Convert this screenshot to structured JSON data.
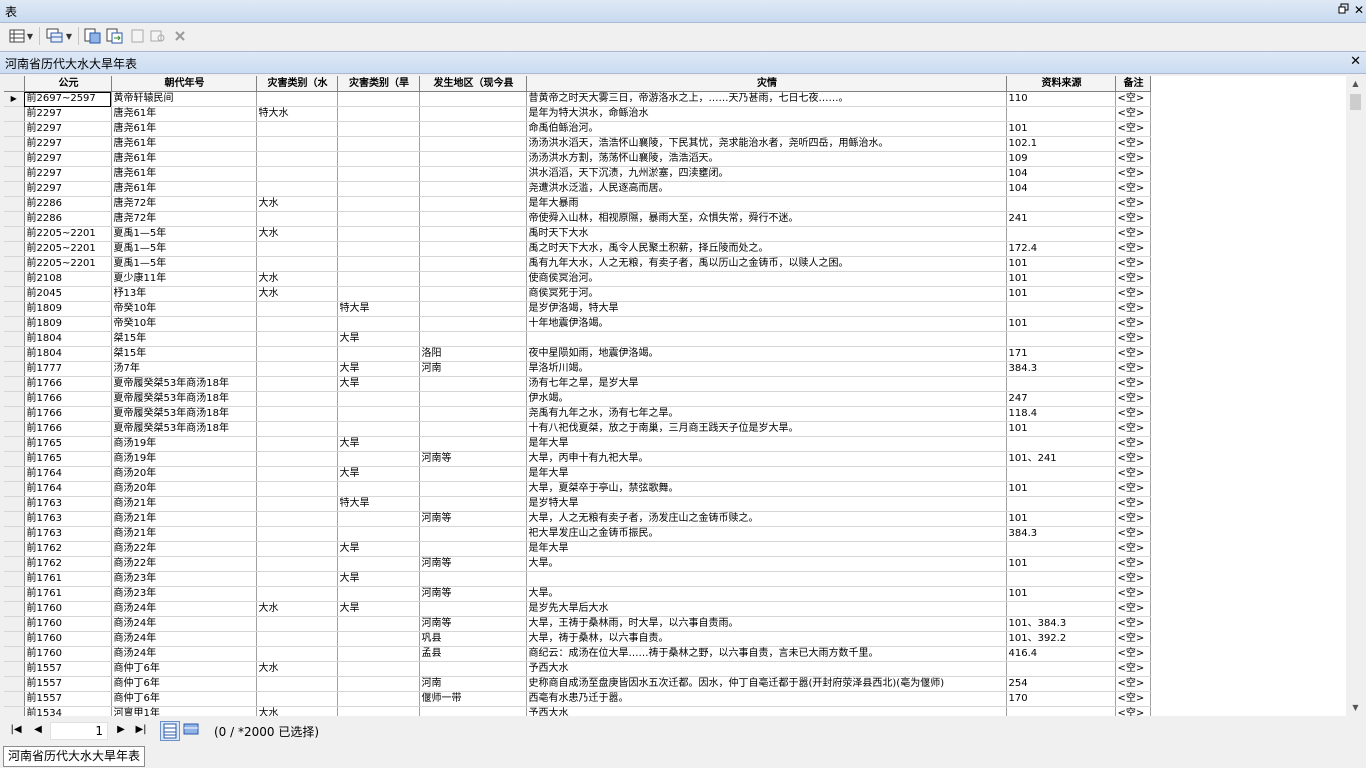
{
  "window": {
    "title": "表"
  },
  "tab": {
    "title": "河南省历代大水大旱年表"
  },
  "columns": [
    "公元",
    "朝代年号",
    "灾害类别（水",
    "灾害类别（旱",
    "发生地区（现今县",
    "灾情",
    "资料来源",
    "备注"
  ],
  "rows": [
    [
      "前2697~2597",
      "黄帝轩辕民间",
      "",
      "",
      "",
      "昔黄帝之时天大雾三日，帝游洛水之上，……天乃甚雨，七日七夜……。",
      "110",
      "<空>"
    ],
    [
      "前2297",
      "唐尧61年",
      "特大水",
      "",
      "",
      "是年为特大洪水，命鲧治水",
      "",
      "<空>"
    ],
    [
      "前2297",
      "唐尧61年",
      "",
      "",
      "",
      "命禹伯鲧治河。",
      "101",
      "<空>"
    ],
    [
      "前2297",
      "唐尧61年",
      "",
      "",
      "",
      "汤汤洪水滔天，浩浩怀山襄陵，下民其忧，尧求能治水者，尧听四岳，用鲧治水。",
      "102.1",
      "<空>"
    ],
    [
      "前2297",
      "唐尧61年",
      "",
      "",
      "",
      "汤汤洪水方割，荡荡怀山襄陵，浩浩滔天。",
      "109",
      "<空>"
    ],
    [
      "前2297",
      "唐尧61年",
      "",
      "",
      "",
      "洪水滔滔，天下沉渍，九州淤塞，四渎壅闭。",
      "104",
      "<空>"
    ],
    [
      "前2297",
      "唐尧61年",
      "",
      "",
      "",
      "尧遭洪水泛滥，人民逐高而居。",
      "104",
      "<空>"
    ],
    [
      "前2286",
      "唐尧72年",
      "大水",
      "",
      "",
      "是年大暴雨",
      "",
      "<空>"
    ],
    [
      "前2286",
      "唐尧72年",
      "",
      "",
      "",
      "帝使舜入山林，相视原隰，暴雨大至，众惧失常，舜行不迷。",
      "241",
      "<空>"
    ],
    [
      "前2205~2201",
      "夏禹1—5年",
      "大水",
      "",
      "",
      "禹时天下大水",
      "",
      "<空>"
    ],
    [
      "前2205~2201",
      "夏禹1—5年",
      "",
      "",
      "",
      "禹之时天下大水，禹令人民聚土积薪，择丘陵而处之。",
      "172.4",
      "<空>"
    ],
    [
      "前2205~2201",
      "夏禹1—5年",
      "",
      "",
      "",
      "禹有九年大水，人之无粮，有卖子者，禹以历山之金铸币，以赎人之困。",
      "101",
      "<空>"
    ],
    [
      "前2108",
      "夏少康11年",
      "大水",
      "",
      "",
      "使商侯冥治河。",
      "101",
      "<空>"
    ],
    [
      "前2045",
      "杼13年",
      "大水",
      "",
      "",
      "商侯冥死于河。",
      "101",
      "<空>"
    ],
    [
      "前1809",
      "帝癸10年",
      "",
      "特大旱",
      "",
      "是岁伊洛竭，特大旱",
      "",
      "<空>"
    ],
    [
      "前1809",
      "帝癸10年",
      "",
      "",
      "",
      "十年地震伊洛竭。",
      "101",
      "<空>"
    ],
    [
      "前1804",
      "桀15年",
      "",
      "大旱",
      "",
      "",
      "",
      "<空>"
    ],
    [
      "前1804",
      "桀15年",
      "",
      "",
      "洛阳",
      "夜中星陨如雨，地震伊洛竭。",
      "171",
      "<空>"
    ],
    [
      "前1777",
      "汤7年",
      "",
      "大旱",
      "河南",
      "旱洛圻川竭。",
      "384.3",
      "<空>"
    ],
    [
      "前1766",
      "夏帝履癸桀53年商汤18年",
      "",
      "大旱",
      "",
      "汤有七年之旱，是岁大旱",
      "",
      "<空>"
    ],
    [
      "前1766",
      "夏帝履癸桀53年商汤18年",
      "",
      "",
      "",
      "伊水竭。",
      "247",
      "<空>"
    ],
    [
      "前1766",
      "夏帝履癸桀53年商汤18年",
      "",
      "",
      "",
      "尧禹有九年之水，汤有七年之旱。",
      "118.4",
      "<空>"
    ],
    [
      "前1766",
      "夏帝履癸桀53年商汤18年",
      "",
      "",
      "",
      "十有八祀伐夏桀，放之于南巢，三月商王践天子位是岁大旱。",
      "101",
      "<空>"
    ],
    [
      "前1765",
      "商汤19年",
      "",
      "大旱",
      "",
      "是年大旱",
      "",
      "<空>"
    ],
    [
      "前1765",
      "商汤19年",
      "",
      "",
      "河南等",
      "大旱，丙申十有九祀大旱。",
      "101、241",
      "<空>"
    ],
    [
      "前1764",
      "商汤20年",
      "",
      "大旱",
      "",
      "是年大旱",
      "",
      "<空>"
    ],
    [
      "前1764",
      "商汤20年",
      "",
      "",
      "",
      "大旱，夏桀卒于亭山，禁弦歌舞。",
      "101",
      "<空>"
    ],
    [
      "前1763",
      "商汤21年",
      "",
      "特大旱",
      "",
      "是岁特大旱",
      "",
      "<空>"
    ],
    [
      "前1763",
      "商汤21年",
      "",
      "",
      "河南等",
      "大旱，人之无粮有卖子者，汤发庄山之金铸币赎之。",
      "101",
      "<空>"
    ],
    [
      "前1763",
      "商汤21年",
      "",
      "",
      "",
      "祀大旱发庄山之金铸币振民。",
      "384.3",
      "<空>"
    ],
    [
      "前1762",
      "商汤22年",
      "",
      "大旱",
      "",
      "是年大旱",
      "",
      "<空>"
    ],
    [
      "前1762",
      "商汤22年",
      "",
      "",
      "河南等",
      "大旱。",
      "101",
      "<空>"
    ],
    [
      "前1761",
      "商汤23年",
      "",
      "大旱",
      "",
      "",
      "",
      "<空>"
    ],
    [
      "前1761",
      "商汤23年",
      "",
      "",
      "河南等",
      "大旱。",
      "101",
      "<空>"
    ],
    [
      "前1760",
      "商汤24年",
      "大水",
      "大旱",
      "",
      "是岁先大旱后大水",
      "",
      "<空>"
    ],
    [
      "前1760",
      "商汤24年",
      "",
      "",
      "河南等",
      "大旱，王祷于桑林雨，时大旱，以六事自责雨。",
      "101、384.3",
      "<空>"
    ],
    [
      "前1760",
      "商汤24年",
      "",
      "",
      "巩县",
      "大旱，祷于桑林，以六事自责。",
      "101、392.2",
      "<空>"
    ],
    [
      "前1760",
      "商汤24年",
      "",
      "",
      "孟县",
      "商纪云：成汤在位大旱……祷于桑林之野，以六事自责，言未已大雨方数千里。",
      "416.4",
      "<空>"
    ],
    [
      "前1557",
      "商仲丁6年",
      "大水",
      "",
      "",
      "予西大水",
      "",
      "<空>"
    ],
    [
      "前1557",
      "商仲丁6年",
      "",
      "",
      "河南",
      "史称商自成汤至盘庚皆因水五次迁都。因水，仲丁自亳迁都于嚣(开封府荥泽县西北)(亳为偃师)",
      "254",
      "<空>"
    ],
    [
      "前1557",
      "商仲丁6年",
      "",
      "",
      "偃师一带",
      "西亳有水患乃迁于嚣。",
      "170",
      "<空>"
    ],
    [
      "前1534",
      "河亶甲1年",
      "大水",
      "",
      "",
      "予西大水",
      "",
      "<空>"
    ]
  ],
  "status": {
    "record_number": "1",
    "selection_text": "(0 / *2000 已选择)"
  },
  "bottom_tab": "河南省历代大水大旱年表",
  "icons": {
    "window_restore": "restore-icon",
    "window_close": "✕",
    "tab_close": "✕",
    "nav_first": "|◀",
    "nav_prev": "◀",
    "nav_next": "▶",
    "nav_last": "▶|"
  }
}
